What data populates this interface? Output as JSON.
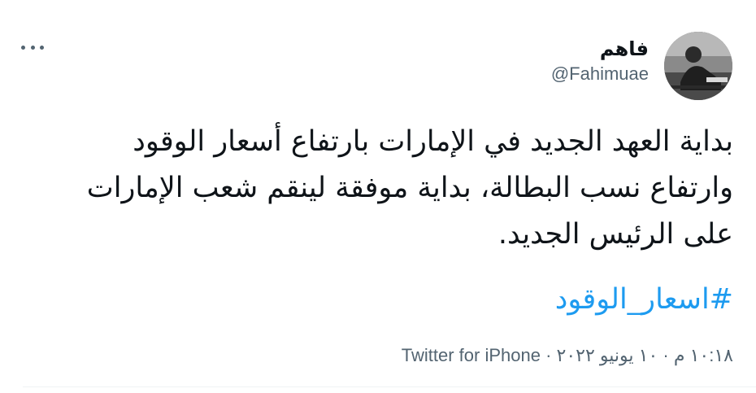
{
  "author": {
    "display_name": "فاهم",
    "handle": "@Fahimuae"
  },
  "tweet": {
    "lines": [
      "بداية العهد الجديد في الإمارات بارتفاع أسعار الوقود",
      "وارتفاع نسب البطالة، بداية موفقة لينقم شعب الإمارات",
      "على الرئيس الجديد."
    ],
    "hashtag": "#اسعار_الوقود",
    "time": "١٠:١٨ م",
    "separator": "·",
    "date": "١٠ يونيو ٢٠٢٢",
    "source": "Twitter for iPhone"
  },
  "icons": {
    "more": "more-horizontal-icon"
  },
  "colors": {
    "text": "#0f1419",
    "secondary": "#536471",
    "link": "#1d9bf0",
    "divider": "#eff3f4"
  }
}
